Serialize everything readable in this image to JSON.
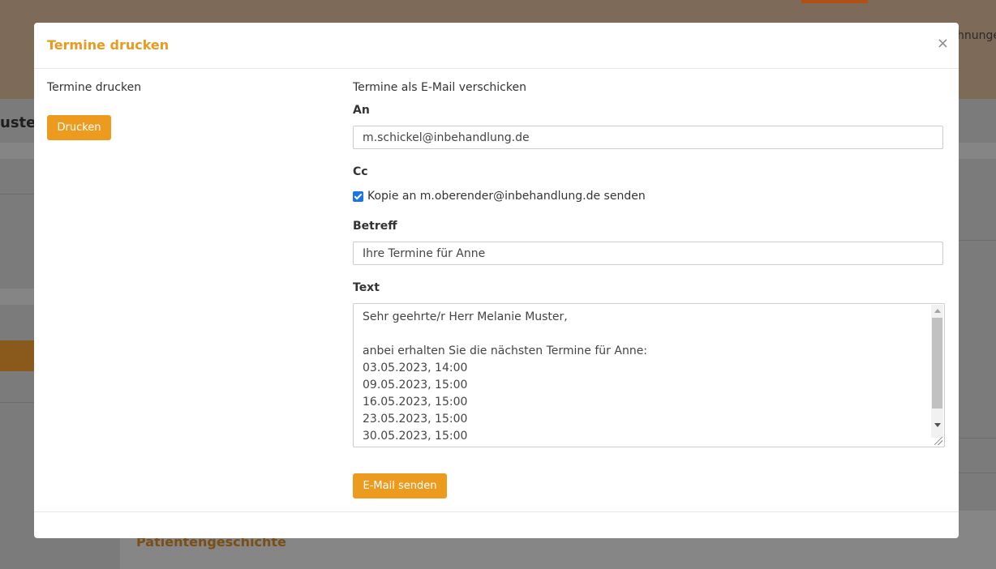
{
  "background": {
    "header_text": "hnunge",
    "page_title": "uster",
    "section_title": "Patientengeschichte"
  },
  "modal": {
    "title": "Termine drucken",
    "close_icon": "close-icon",
    "left": {
      "heading": "Termine drucken",
      "print_button": "Drucken"
    },
    "email": {
      "heading": "Termine als E-Mail verschicken",
      "to_label": "An",
      "to_value": "m.schickel@inbehandlung.de",
      "cc_label": "Cc",
      "cc_checked": true,
      "cc_option": "Kopie an m.oberender@inbehandlung.de senden",
      "subject_label": "Betreff",
      "subject_value": "Ihre Termine für Anne",
      "text_label": "Text",
      "text_value": "Sehr geehrte/r Herr Melanie Muster,\n\nanbei erhalten Sie die nächsten Termine für Anne:\n03.05.2023, 14:00\n09.05.2023, 15:00\n16.05.2023, 15:00\n23.05.2023, 15:00\n30.05.2023, 15:00",
      "send_button": "E-Mail senden"
    }
  },
  "colors": {
    "accent": "#ec9b1f",
    "title": "#e99a1f",
    "checkbox": "#1a73e8"
  }
}
